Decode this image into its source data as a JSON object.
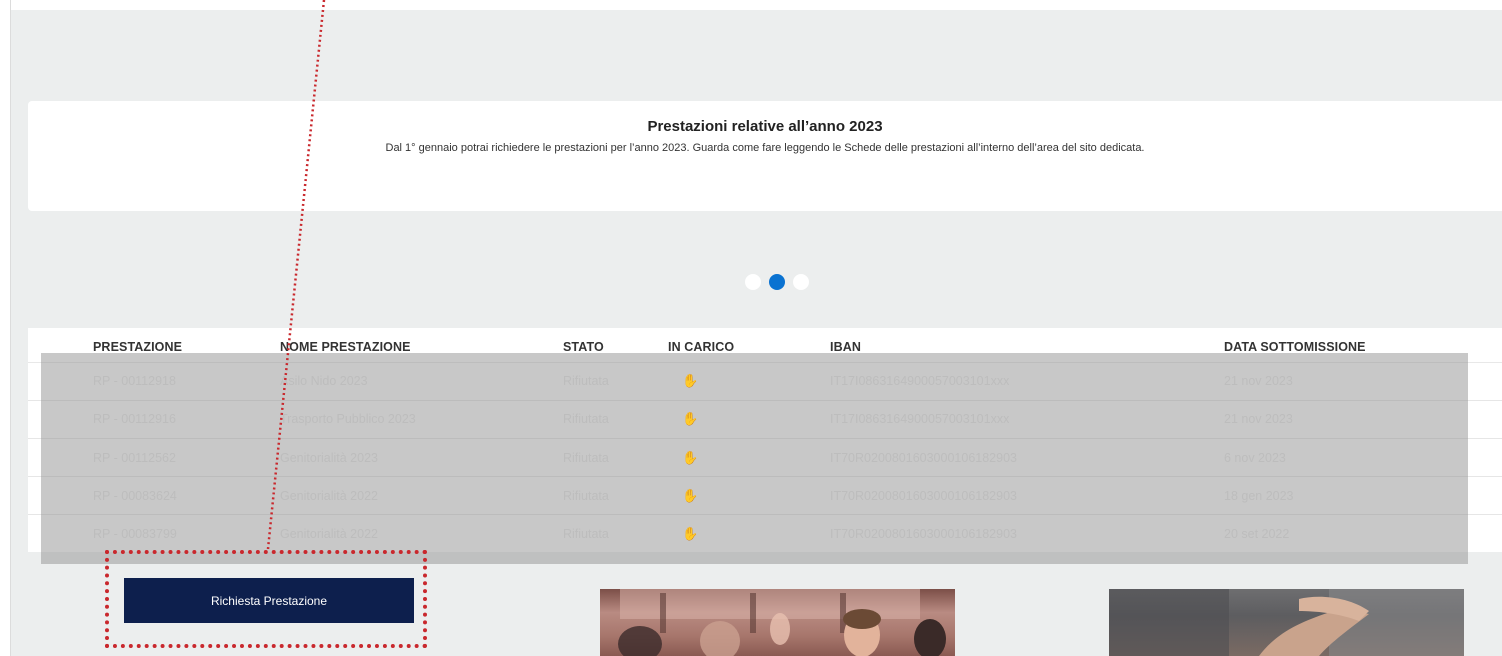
{
  "banner": {
    "title": "Prestazioni relative all’anno 2023",
    "text": "Dal 1° gennaio potrai richiedere le prestazioni per l’anno 2023. Guarda come fare leggendo le Schede delle prestazioni all’interno dell’area del sito dedicata."
  },
  "carousel": {
    "slide_count": 3,
    "active_index": 1,
    "accent_color": "#0a72d1"
  },
  "table": {
    "headers": [
      "PRESTAZIONE",
      "NOME PRESTAZIONE",
      "STATO",
      "IN CARICO",
      "IBAN",
      "DATA SOTTOMISSIONE"
    ],
    "rows": [
      {
        "id": "RP - 00112918",
        "name": "Asilo Nido 2023",
        "status": "Rifiutata",
        "icon": "hand-icon",
        "iban": "IT17I0863164900057003101xxx",
        "date": "21 nov 2023"
      },
      {
        "id": "RP - 00112916",
        "name": "Trasporto Pubblico 2023",
        "status": "Rifiutata",
        "icon": "hand-icon",
        "iban": "IT17I0863164900057003101xxx",
        "date": "21 nov 2023"
      },
      {
        "id": "RP - 00112562",
        "name": "Genitorialità 2023",
        "status": "Rifiutata",
        "icon": "hand-icon",
        "iban": "IT70R0200801603000106182903",
        "date": "6 nov 2023"
      },
      {
        "id": "RP - 00083624",
        "name": "Genitorialità 2022",
        "status": "Rifiutata",
        "icon": "hand-icon",
        "iban": "IT70R0200801603000106182903",
        "date": "18 gen 2023"
      },
      {
        "id": "RP - 00083799",
        "name": "Genitorialità 2022",
        "status": "Rifiutata",
        "icon": "hand-icon",
        "iban": "IT70R0200801603000106182903",
        "date": "20 set 2022"
      }
    ]
  },
  "cta": {
    "label": "Richiesta Prestazione",
    "color": "#0d1f4d",
    "highlight_color": "#c9282d"
  },
  "promos": [
    {
      "image": "people-raising-hands-photo"
    },
    {
      "image": "holding-hands-photo"
    }
  ]
}
